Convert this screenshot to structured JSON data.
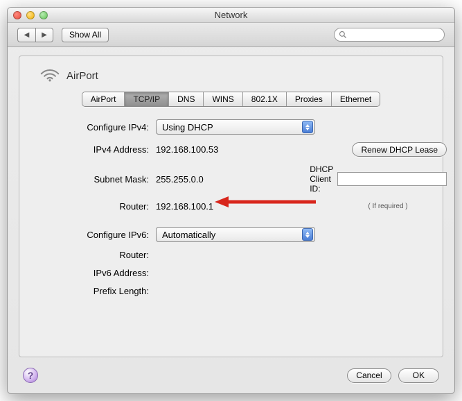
{
  "window": {
    "title": "Network"
  },
  "toolbar": {
    "showAll": "Show All"
  },
  "sheet": {
    "title": "AirPort"
  },
  "tabs": [
    "AirPort",
    "TCP/IP",
    "DNS",
    "WINS",
    "802.1X",
    "Proxies",
    "Ethernet"
  ],
  "activeTabIndex": 1,
  "labels": {
    "configureIPv4": "Configure IPv4:",
    "ipv4Address": "IPv4 Address:",
    "subnetMask": "Subnet Mask:",
    "router": "Router:",
    "configureIPv6": "Configure IPv6:",
    "ipv6Router": "Router:",
    "ipv6Address": "IPv6 Address:",
    "prefixLength": "Prefix Length:",
    "dhcpClientId": "DHCP Client ID:",
    "ifRequired": "( If required )"
  },
  "values": {
    "configureIPv4": "Using DHCP",
    "ipv4Address": "192.168.100.53",
    "subnetMask": "255.255.0.0",
    "router": "192.168.100.1",
    "configureIPv6": "Automatically",
    "ipv6Router": "",
    "ipv6Address": "",
    "prefixLength": "",
    "dhcpClientId": ""
  },
  "buttons": {
    "renewDhcp": "Renew DHCP Lease",
    "cancel": "Cancel",
    "ok": "OK",
    "help": "?"
  }
}
